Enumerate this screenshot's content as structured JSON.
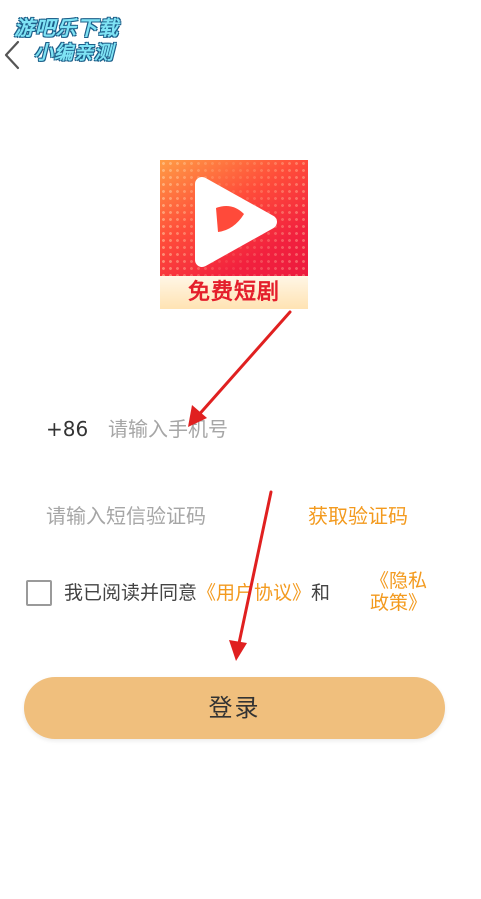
{
  "watermark": {
    "line1": "游吧乐下载",
    "line2": "小编亲测"
  },
  "nav": {
    "back_icon": "chevron-left-icon"
  },
  "logo": {
    "banner_text": "免费短剧",
    "icon": "play-icon"
  },
  "phone": {
    "country_code": "+86",
    "placeholder": "请输入手机号",
    "value": ""
  },
  "sms": {
    "placeholder": "请输入短信验证码",
    "value": "",
    "get_code_label": "获取验证码"
  },
  "agreement": {
    "checked": false,
    "prefix": "我已阅读并同意",
    "user_agreement": "《用户协议》",
    "and": "和",
    "privacy_line1": "《隐私",
    "privacy_line2": "政策》"
  },
  "login": {
    "label": "登录"
  },
  "colors": {
    "accent": "#f39a1e",
    "button": "#f0bf7d",
    "arrow": "#e02020"
  }
}
